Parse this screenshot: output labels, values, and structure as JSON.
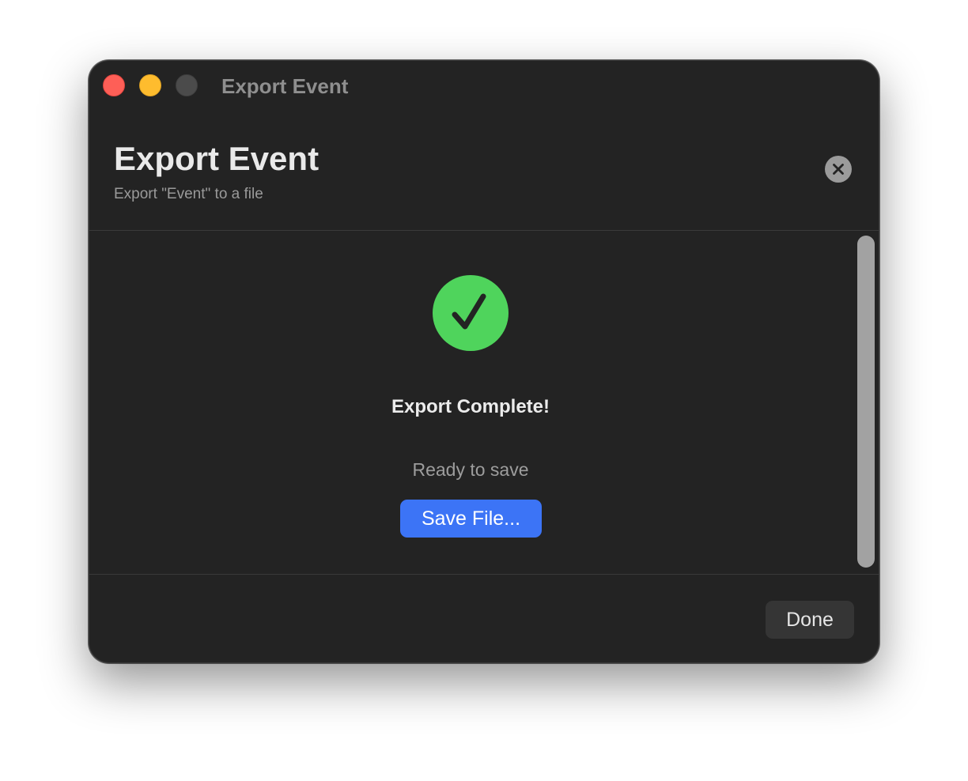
{
  "window": {
    "title": "Export Event",
    "traffic_lights": [
      "close",
      "minimize",
      "zoom"
    ]
  },
  "header": {
    "title": "Export Event",
    "subtitle": "Export \"Event\" to a file",
    "close_icon": "xmark-circle-icon"
  },
  "content": {
    "status_icon": "checkmark-circle-icon",
    "heading": "Export Complete!",
    "status": "Ready to save",
    "save_button_label": "Save File..."
  },
  "footer": {
    "done_button_label": "Done"
  },
  "colors": {
    "window_background": "#232323",
    "success_green": "#4fd45c",
    "accent_blue": "#3c74f6",
    "close_red": "#fe5f57",
    "minimize_yellow": "#febc2e"
  }
}
